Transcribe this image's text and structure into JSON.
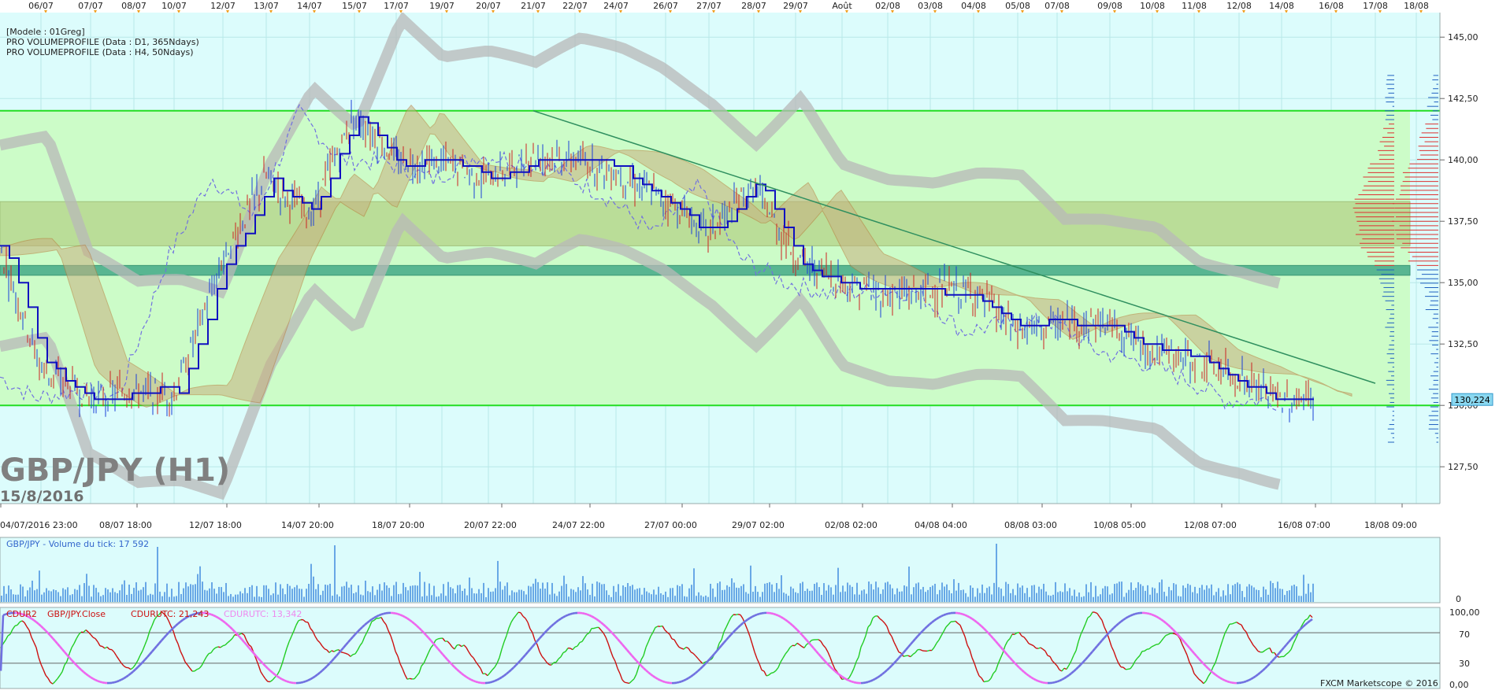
{
  "colors": {
    "bg": "#dcfcfc",
    "zone": "#ccfcc8",
    "zone_line": "#22dd22",
    "resistance_band": "#b8d890",
    "pivot_band": "#44aa88",
    "trendline": "#2f8f5f",
    "candle_up": "#1a3fd8",
    "candle_down": "#cc2222",
    "kijun": "#1010c0",
    "chikou": "#7070e0",
    "bollinger": "#b8b8b8",
    "profile_red": "#dd3030",
    "profile_blue": "#2060c0",
    "volume_bar": "#1a6fd8",
    "osc_green": "#22cc22",
    "osc_red": "#cc1111",
    "osc_pink": "#ee66ee",
    "osc_blue": "#7070e0",
    "price_tag": "#8ad8f0"
  },
  "top_dates": [
    "06/07",
    "07/07",
    "08/07",
    "10/07",
    "12/07",
    "13/07",
    "14/07",
    "15/07",
    "17/07",
    "19/07",
    "20/07",
    "21/07",
    "22/07",
    "24/07",
    "26/07",
    "27/07",
    "28/07",
    "29/07",
    "Août",
    "02/08",
    "03/08",
    "04/08",
    "05/08",
    "07/08",
    "09/08",
    "10/08",
    "11/08",
    "12/08",
    "14/08",
    "16/08",
    "17/08",
    "18/08"
  ],
  "info_lines": [
    "[Modele : 01Greg]",
    "PRO VOLUMEPROFILE (Data : D1, 365Ndays)",
    "PRO VOLUMEPROFILE (Data : H4, 50Ndays)"
  ],
  "watermark": {
    "symbol": "GBP/JPY (H1)",
    "date": "15/8/2016"
  },
  "price_axis": [
    "145,00",
    "142,50",
    "140,00",
    "137,50",
    "135,00",
    "132,50",
    "130,00",
    "127,50"
  ],
  "last_price": "130,224",
  "time_axis": [
    "04/07/2016 23:00",
    "08/07 18:00",
    "12/07 18:00",
    "14/07 20:00",
    "18/07 20:00",
    "20/07 22:00",
    "24/07 22:00",
    "27/07 00:00",
    "29/07 02:00",
    "02/08 02:00",
    "04/08 04:00",
    "08/08 03:00",
    "10/08 05:00",
    "12/08 07:00",
    "16/08 07:00",
    "18/08 09:00"
  ],
  "volume_panel": {
    "label": "GBP/JPY - Volume du tick: 17 592",
    "axis": [
      "0"
    ]
  },
  "osc_panel": {
    "labels": [
      {
        "text": "CDUR2",
        "color": "#cc1111"
      },
      {
        "text": "GBP/JPY.Close",
        "color": "#cc1111"
      },
      {
        "text": "CDURUTC: 21,243",
        "color": "#cc1111"
      },
      {
        "text": "CDURUTC: 13,342",
        "color": "#ee88ee"
      }
    ],
    "axis": [
      "100,00",
      "70",
      "30",
      "0,00"
    ]
  },
  "copyright": "FXCM Marketscope © 2016",
  "chart_data": [
    {
      "type": "candlestick",
      "title": "GBP/JPY (H1)",
      "date": "15/8/2016",
      "ylim": [
        126.0,
        146.0
      ],
      "levels": {
        "resistance_line": 142.0,
        "support_line": 130.0,
        "resistance_zone": [
          136.5,
          138.3
        ],
        "pivot_zone": [
          135.3,
          135.7
        ]
      },
      "trendline": {
        "start": [
          "21/07",
          142.0
        ],
        "end": [
          "17/08",
          130.9
        ]
      },
      "path": [
        [
          "04/07",
          136.4
        ],
        [
          "06/07",
          131.5
        ],
        [
          "07/07",
          130.3
        ],
        [
          "08/07",
          130.6
        ],
        [
          "10/07",
          130.4
        ],
        [
          "12/07",
          136.0
        ],
        [
          "13/07",
          139.3
        ],
        [
          "14/07",
          137.7
        ],
        [
          "15/07",
          141.9
        ],
        [
          "17/07",
          140.0
        ],
        [
          "19/07",
          139.9
        ],
        [
          "20/07",
          139.2
        ],
        [
          "21/07",
          140.2
        ],
        [
          "22/07",
          140.0
        ],
        [
          "24/07",
          139.5
        ],
        [
          "26/07",
          138.4
        ],
        [
          "27/07",
          137.0
        ],
        [
          "28/07",
          138.9
        ],
        [
          "29/07",
          136.0
        ],
        [
          "Août",
          135.0
        ],
        [
          "02/08",
          134.5
        ],
        [
          "03/08",
          134.7
        ],
        [
          "04/08",
          134.6
        ],
        [
          "05/08",
          133.0
        ],
        [
          "07/08",
          133.3
        ],
        [
          "09/08",
          133.4
        ],
        [
          "10/08",
          132.2
        ],
        [
          "11/08",
          131.8
        ],
        [
          "12/08",
          131.1
        ],
        [
          "14/08",
          130.2
        ]
      ],
      "last_price": 130.224
    },
    {
      "type": "bar",
      "title": "GBP/JPY - Volume du tick",
      "last_value": 17592
    },
    {
      "type": "line",
      "title": "CDUR2 GBP/JPY.Close",
      "ylim": [
        0,
        100
      ],
      "levels": [
        30,
        70
      ],
      "series": [
        {
          "name": "CDURUTC",
          "last_value": 21.243
        },
        {
          "name": "CDURUTC",
          "last_value": 13.342
        }
      ]
    }
  ]
}
